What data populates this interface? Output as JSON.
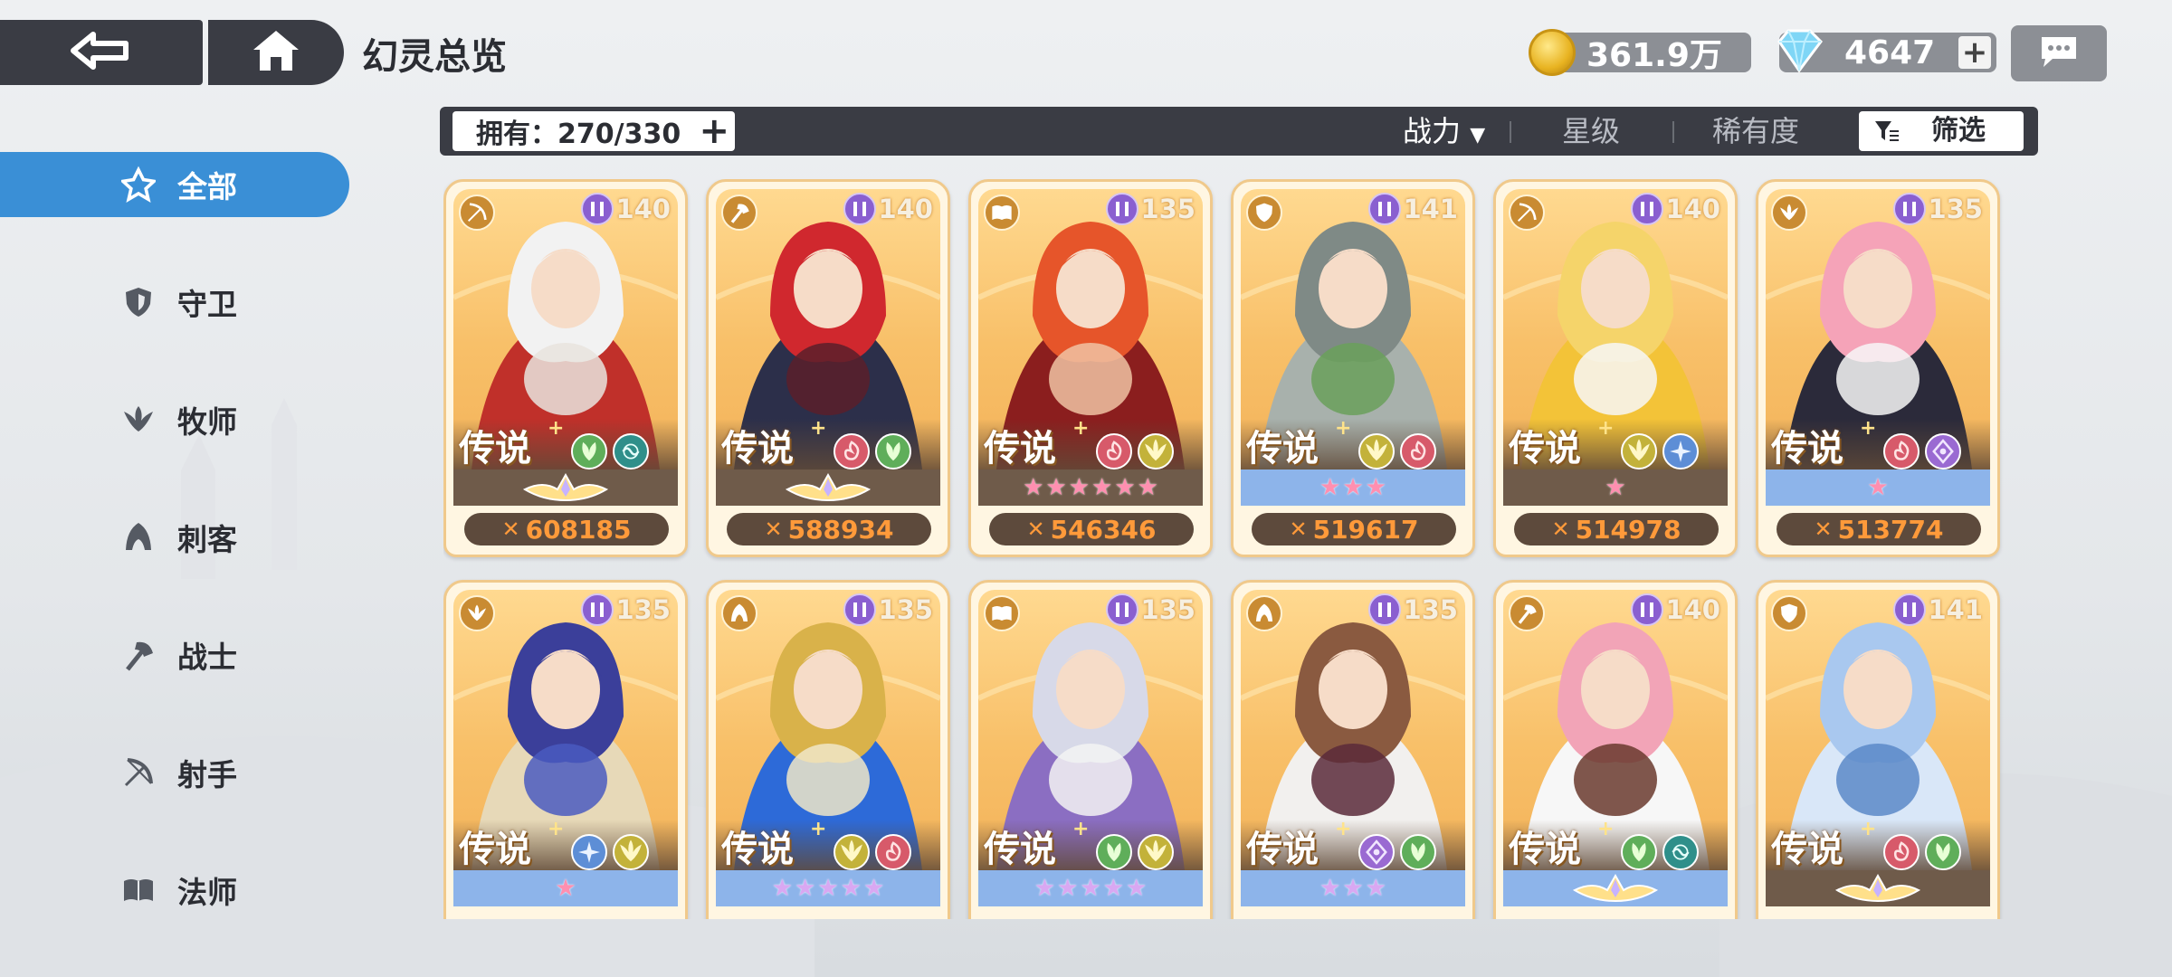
{
  "header": {
    "title": "幻灵总览",
    "gold": "361.9万",
    "gems": "4647"
  },
  "sidebar": {
    "items": [
      {
        "label": "全部",
        "icon": "all-classes-icon",
        "active": true
      },
      {
        "label": "守卫",
        "icon": "shield-icon",
        "active": false
      },
      {
        "label": "牧师",
        "icon": "wings-icon",
        "active": false
      },
      {
        "label": "刺客",
        "icon": "hood-icon",
        "active": false
      },
      {
        "label": "战士",
        "icon": "axe-icon",
        "active": false
      },
      {
        "label": "射手",
        "icon": "bow-icon",
        "active": false
      },
      {
        "label": "法师",
        "icon": "book-icon",
        "active": false
      }
    ]
  },
  "filterbar": {
    "owned": "拥有：270/330",
    "sort_power": "战力",
    "sort_star": "星级",
    "sort_rarity": "稀有度",
    "filter": "筛选"
  },
  "colors": {
    "accent": "#3a8fd6",
    "dark_panel": "#3a3c44",
    "power_text": "#ff9a3a",
    "card_border": "#f0c98b"
  },
  "cards": [
    {
      "class_icon": "bow-icon",
      "level": "140",
      "rarity": "传说",
      "elements": [
        "nature-icon",
        "water-icon"
      ],
      "stars": {
        "type": "crown",
        "count": 0,
        "strip": "dark"
      },
      "power": "608185"
    },
    {
      "class_icon": "axe-icon",
      "level": "140",
      "rarity": "传说",
      "elements": [
        "fire-icon",
        "nature-icon"
      ],
      "stars": {
        "type": "crown",
        "count": 0,
        "strip": "dark"
      },
      "power": "588934"
    },
    {
      "class_icon": "book-icon",
      "level": "135",
      "rarity": "传说",
      "elements": [
        "fire-icon",
        "light-icon"
      ],
      "stars": {
        "type": "pink",
        "count": 6,
        "strip": "dark"
      },
      "power": "546346"
    },
    {
      "class_icon": "shield-icon",
      "level": "141",
      "rarity": "传说",
      "elements": [
        "light-icon",
        "fire-icon"
      ],
      "stars": {
        "type": "pink",
        "count": 3,
        "strip": "blue"
      },
      "power": "519617"
    },
    {
      "class_icon": "bow-icon",
      "level": "140",
      "rarity": "传说",
      "elements": [
        "light-icon",
        "ice-icon"
      ],
      "stars": {
        "type": "pink",
        "count": 1,
        "strip": "dark"
      },
      "power": "514978"
    },
    {
      "class_icon": "wings-icon",
      "level": "135",
      "rarity": "传说",
      "elements": [
        "fire-icon",
        "void-icon"
      ],
      "stars": {
        "type": "pink",
        "count": 1,
        "strip": "blue"
      },
      "power": "513774"
    },
    {
      "class_icon": "wings-icon",
      "level": "135",
      "rarity": "传说",
      "elements": [
        "ice-icon",
        "light-icon"
      ],
      "stars": {
        "type": "pink",
        "count": 1,
        "strip": "blue"
      },
      "power": ""
    },
    {
      "class_icon": "hood-icon",
      "level": "135",
      "rarity": "传说",
      "elements": [
        "light-icon",
        "fire-icon"
      ],
      "stars": {
        "type": "purple",
        "count": 5,
        "strip": "blue"
      },
      "power": ""
    },
    {
      "class_icon": "book-icon",
      "level": "135",
      "rarity": "传说",
      "elements": [
        "nature-icon",
        "light-icon"
      ],
      "stars": {
        "type": "purple",
        "count": 5,
        "strip": "blue"
      },
      "power": ""
    },
    {
      "class_icon": "hood-icon",
      "level": "135",
      "rarity": "传说",
      "elements": [
        "void-icon",
        "nature-icon"
      ],
      "stars": {
        "type": "purple",
        "count": 3,
        "strip": "blue"
      },
      "power": ""
    },
    {
      "class_icon": "axe-icon",
      "level": "140",
      "rarity": "传说",
      "elements": [
        "nature-icon",
        "water-icon"
      ],
      "stars": {
        "type": "crown",
        "count": 0,
        "strip": "blue"
      },
      "power": ""
    },
    {
      "class_icon": "shield-icon",
      "level": "141",
      "rarity": "传说",
      "elements": [
        "fire-icon",
        "nature-icon"
      ],
      "stars": {
        "type": "crown",
        "count": 0,
        "strip": "dark"
      },
      "power": ""
    }
  ]
}
